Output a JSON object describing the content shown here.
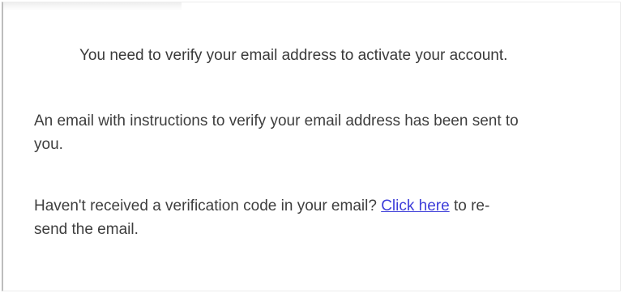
{
  "verification": {
    "heading": "You need to verify your email address to activate your account.",
    "sent_message_line1": "An email with instructions to verify your email address has been sent to",
    "sent_message_line2": "you.",
    "resend_prefix": "Haven't received a verification code in your email?",
    "resend_link": "Click here",
    "resend_suffix_line1": "to re-",
    "resend_suffix_line2": "send the email."
  },
  "colors": {
    "text": "#3e3e3e",
    "link": "#3d3dd9",
    "border": "#bdbdbd"
  }
}
